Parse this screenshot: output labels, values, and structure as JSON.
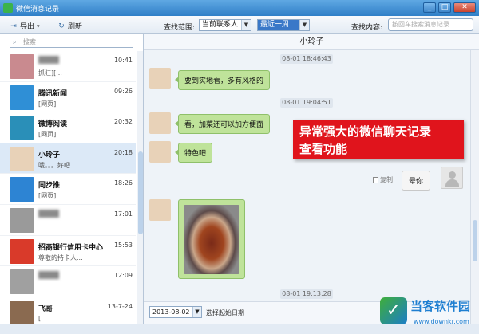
{
  "window": {
    "title": "微信消息记录"
  },
  "toolbar": {
    "export_label": "导出",
    "refresh_label": "刷新",
    "scope_label": "查找范围:",
    "contact_select": "当前联系人",
    "period_select": "最近一周",
    "content_label": "查找内容:",
    "content_placeholder": "按回车搜索消息记录"
  },
  "sidebar": {
    "search_placeholder": "搜索",
    "contacts": [
      {
        "name": "",
        "msg": "抓狂][...",
        "time": "10:41",
        "color": "#c98a8f"
      },
      {
        "name": "腾讯新闻",
        "msg": "[网页]",
        "time": "09:26",
        "color": "#2f8fd6"
      },
      {
        "name": "微博阅读",
        "msg": "[网页]",
        "time": "20:32",
        "color": "#2a8fb8"
      },
      {
        "name": "小玲子",
        "msg": "哦。。。好吧",
        "time": "20:18",
        "color": "#e8d2b8"
      },
      {
        "name": "同步推",
        "msg": "[网页]",
        "time": "18:26",
        "color": "#2d84d3"
      },
      {
        "name": "",
        "msg": "",
        "time": "17:01",
        "color": "#9a9a9a"
      },
      {
        "name": "招商银行信用卡中心",
        "msg": "尊敬的持卡人...",
        "time": "15:53",
        "color": "#d93a2a"
      },
      {
        "name": "",
        "msg": "",
        "time": "12:09",
        "color": "#a0a0a0"
      },
      {
        "name": "飞哥",
        "msg": "[...",
        "time": "13-7-24",
        "color": "#8a6a50"
      }
    ]
  },
  "chat": {
    "contact_name": "小玲子",
    "timestamps": [
      "08-01 18:46:43",
      "08-01 19:04:51",
      "08-01 19:13:28"
    ],
    "messages": [
      "要到实地看，多有风格的",
      "看，加菜还可以加方便面",
      "特色吧"
    ],
    "self_message": "晕你",
    "copy_label": "复制"
  },
  "bottom": {
    "date_value": "2013-08-02",
    "date_label": "选择起始日期"
  },
  "annotation": {
    "line1": "异常强大的微信聊天记录",
    "line2": "查看功能"
  },
  "watermark": {
    "brand": "当客软件园",
    "url": "www.downkr.com"
  }
}
